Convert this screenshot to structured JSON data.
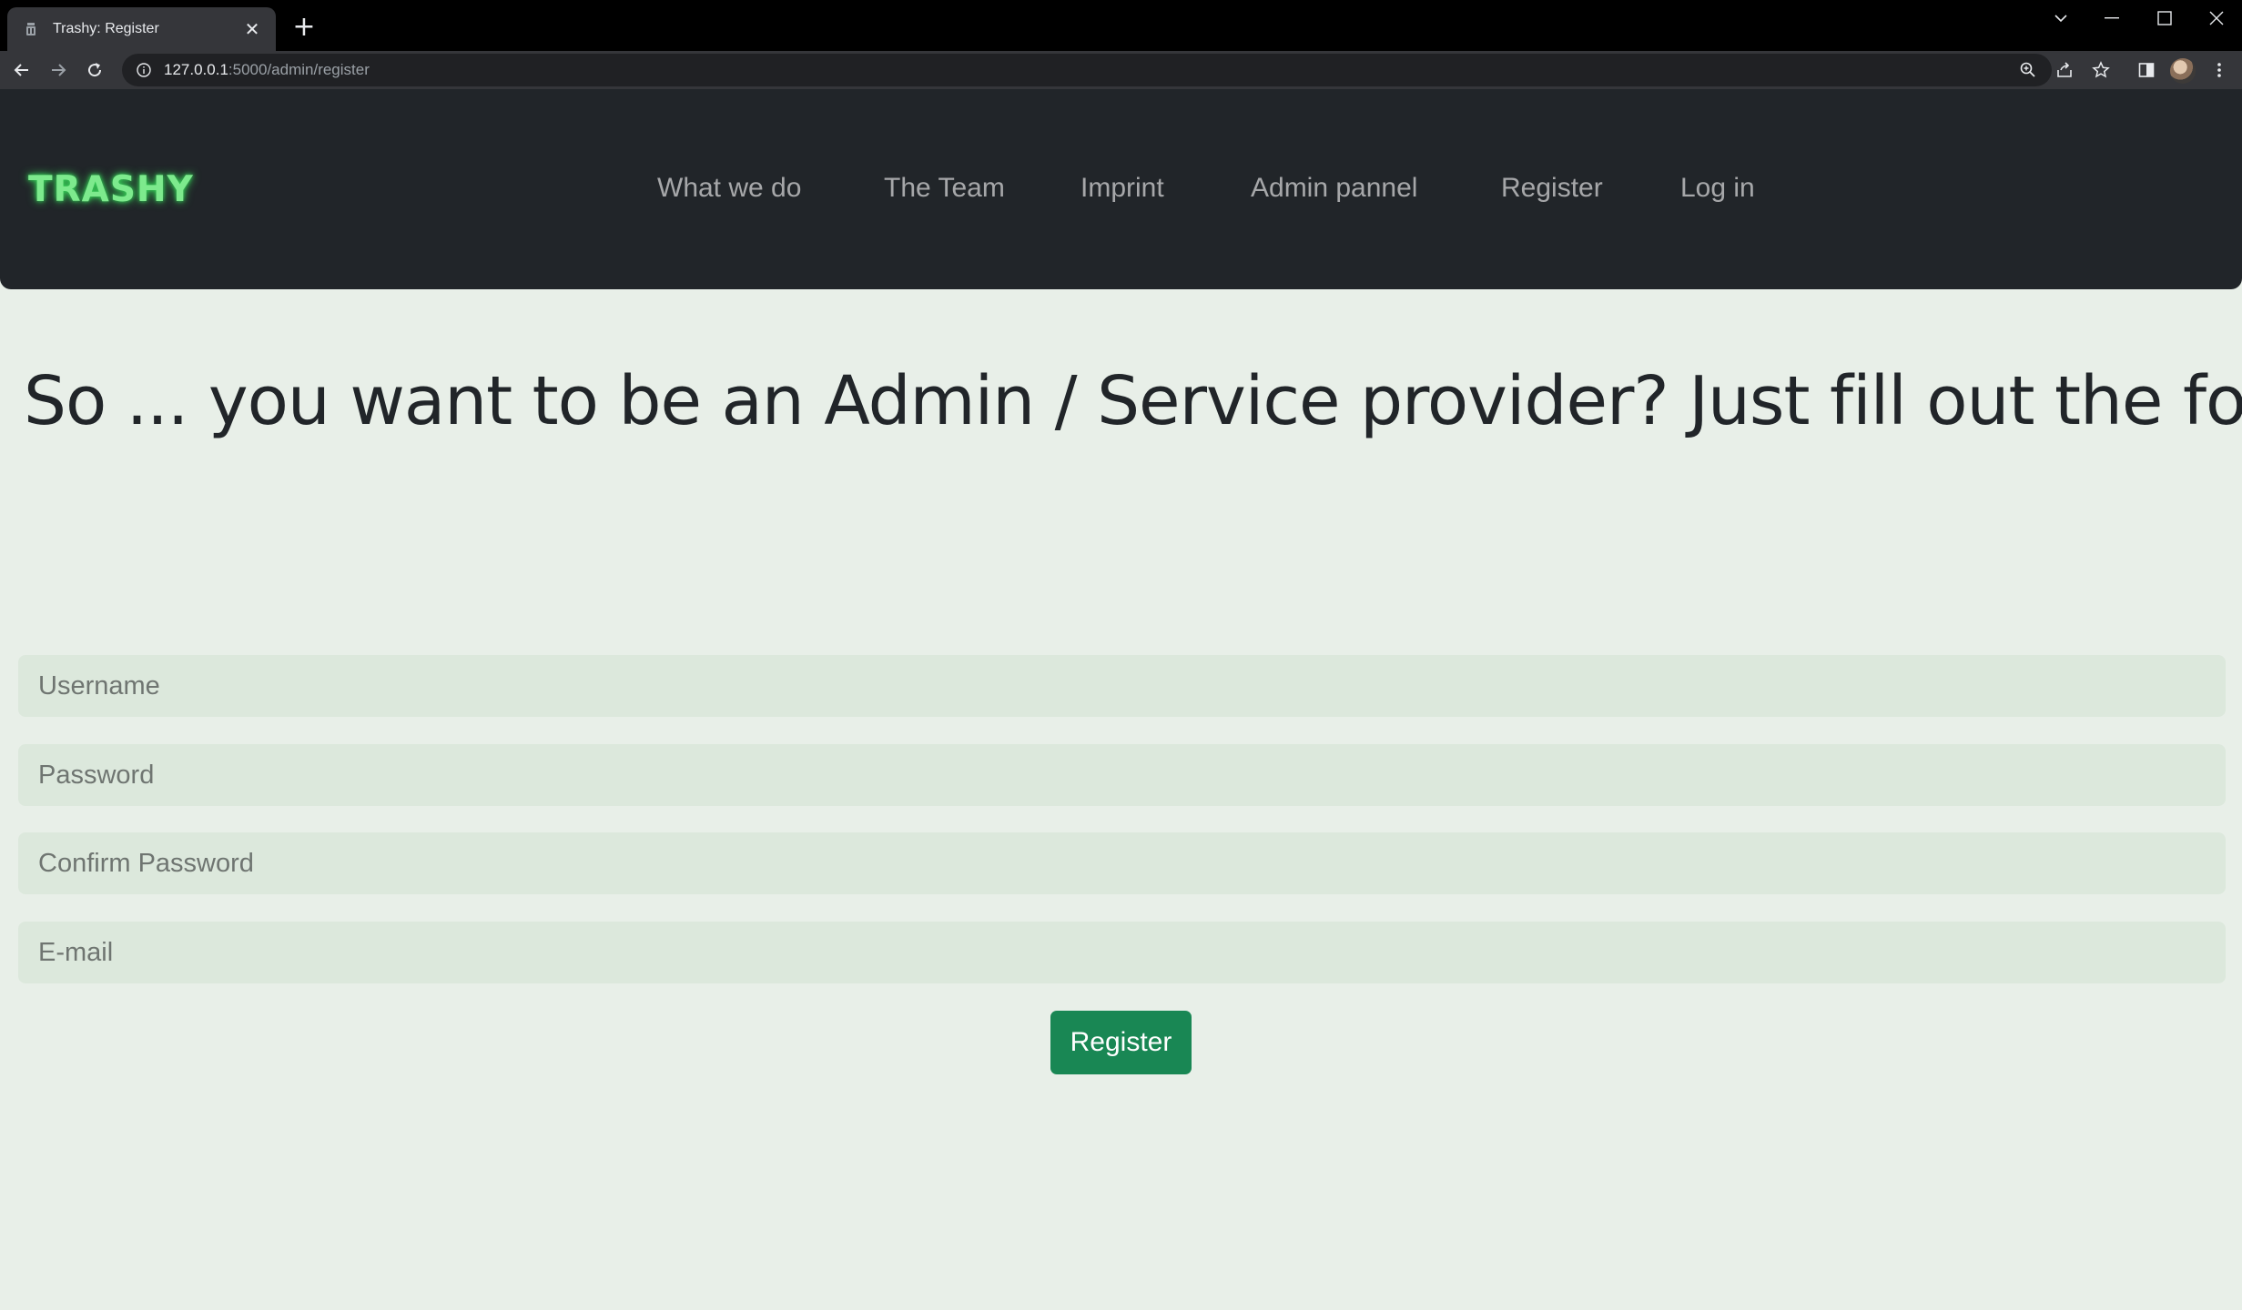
{
  "browser": {
    "tab_title": "Trashy: Register",
    "tab_close": "✕",
    "new_tab": "+",
    "url_host": "127.0.0.1",
    "url_path": ":5000/admin/register"
  },
  "navbar": {
    "brand": "TRASHY",
    "links": [
      "What we do",
      "The Team",
      "Imprint",
      "Admin pannel",
      "Register",
      "Log in"
    ]
  },
  "main": {
    "headline": "So ... you want to be an Admin / Service provider? Just fill out the form"
  },
  "form": {
    "username_placeholder": "Username",
    "password_placeholder": "Password",
    "confirm_password_placeholder": "Confirm Password",
    "email_placeholder": "E-mail",
    "submit_label": "Register"
  },
  "colors": {
    "navbar_bg": "#212529",
    "page_bg": "#e8efe8",
    "brand_green": "#7dea8d",
    "button_green": "#198754"
  }
}
